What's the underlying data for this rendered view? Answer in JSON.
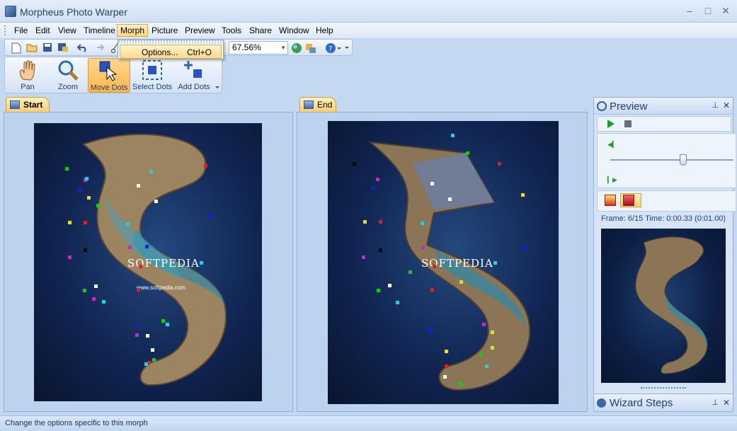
{
  "window": {
    "title": "Morpheus Photo Warper",
    "minimize": "–",
    "maximize": "□",
    "close": "✕"
  },
  "menu": [
    "File",
    "Edit",
    "View",
    "Timeline",
    "Morph",
    "Picture",
    "Preview",
    "Tools",
    "Share",
    "Window",
    "Help"
  ],
  "dropdown": {
    "label": "Options...",
    "shortcut": "Ctrl+O"
  },
  "toolbar": {
    "zoom": "67.56%"
  },
  "tools": [
    {
      "label": "Pan",
      "icon": "hand-icon"
    },
    {
      "label": "Zoom",
      "icon": "magnifier-icon"
    },
    {
      "label": "Move Dots",
      "icon": "cursor-icon"
    },
    {
      "label": "Select Dots",
      "icon": "select-icon"
    },
    {
      "label": "Add Dots",
      "icon": "plus-icon"
    }
  ],
  "panes": {
    "start_tab": "Start",
    "end_tab": "End",
    "watermark": "SOFTPEDIA",
    "watermark_url": "www.softpedia.com"
  },
  "preview": {
    "title": "Preview",
    "frame_text": "Frame: 6/15 Time: 0:00.33 (0:01.00)",
    "slider_fraction": 0.6
  },
  "wizard": {
    "title": "Wizard Steps"
  },
  "status": "Change the options specific to this morph"
}
